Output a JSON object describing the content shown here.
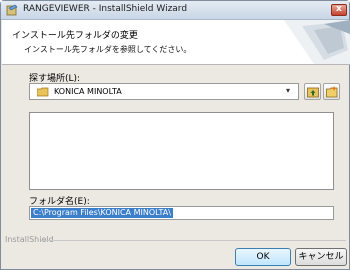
{
  "window": {
    "title": "RANGEVIEWER - InstallShield Wizard"
  },
  "header": {
    "title": "インストール先フォルダの変更",
    "subtitle": "インストール先フォルダを参照してください。"
  },
  "look_in": {
    "label": "探す場所(L):",
    "value": "KONICA MINOLTA",
    "arrow": "▾"
  },
  "folder_name": {
    "label": "フォルダ名(E):",
    "value": "C:\\Program Files\\KONICA MINOLTA\\"
  },
  "footer": {
    "brand": "InstallShield",
    "ok_label": "OK",
    "cancel_label": "キャンセル"
  },
  "colors": {
    "selection": "#3b7ec9",
    "ok_border": "#3c7fb1"
  }
}
